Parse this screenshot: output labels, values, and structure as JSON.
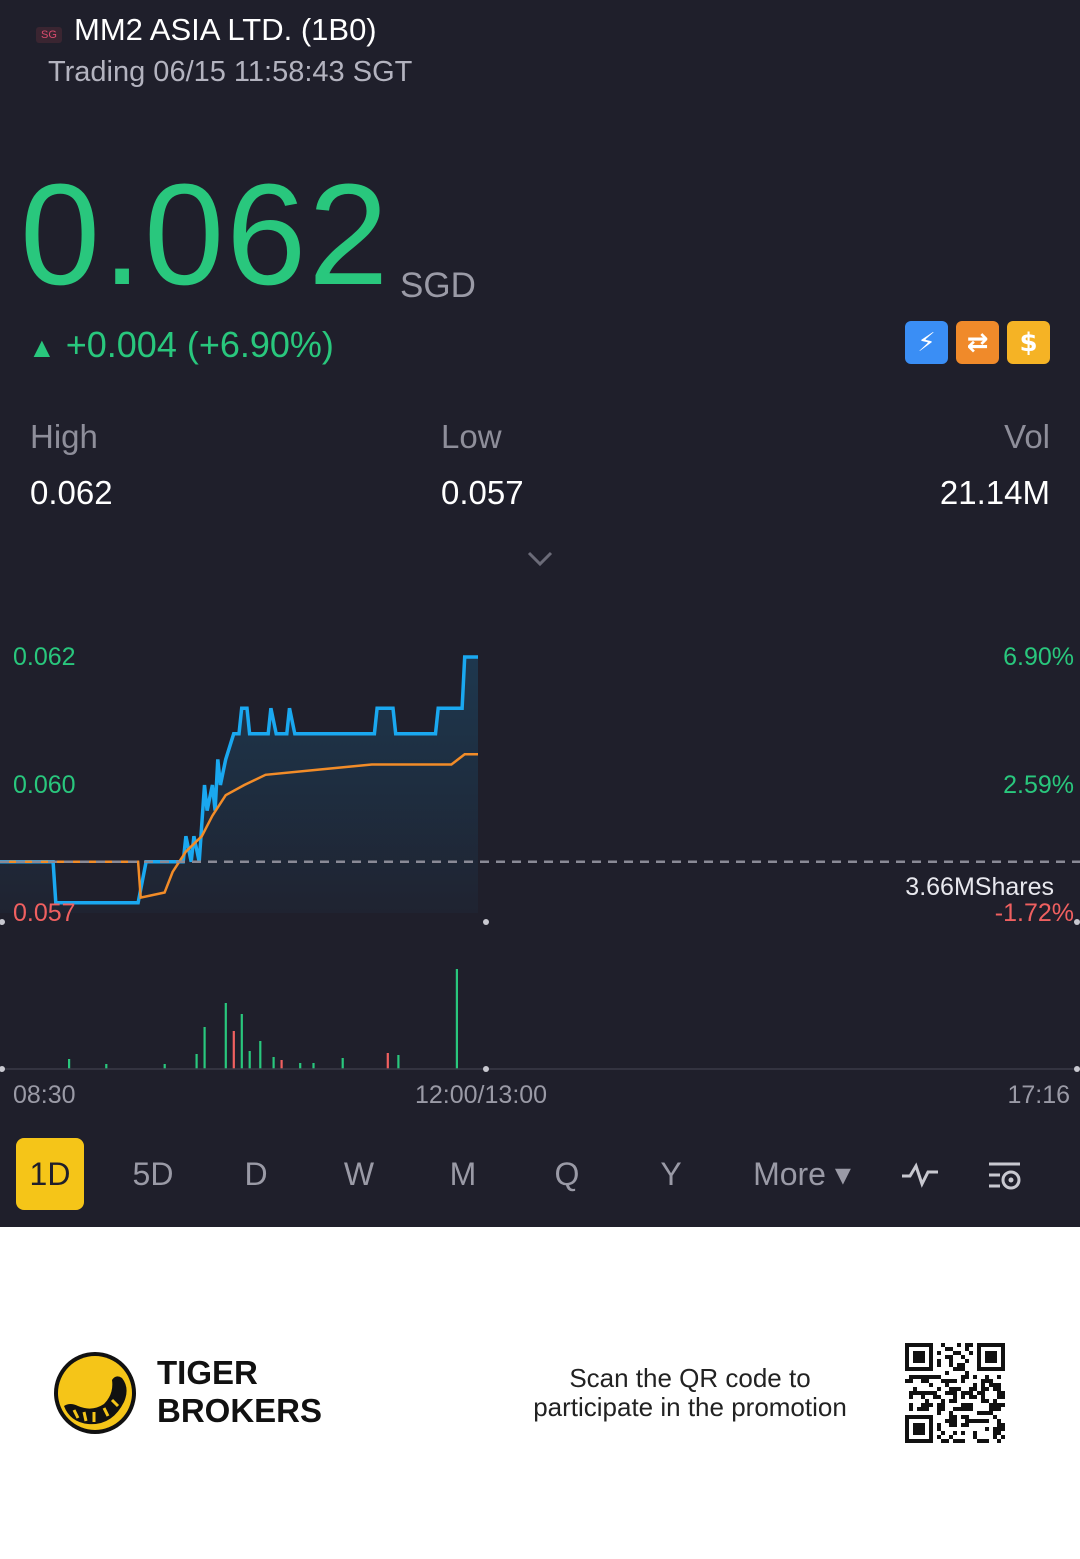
{
  "header": {
    "market": "SG",
    "title": "MM2 ASIA LTD. (1B0)",
    "status_time": "Trading 06/15 11:58:43 SGT"
  },
  "quote": {
    "price": "0.062",
    "currency": "SGD",
    "change_arrow": "▲",
    "change": "+0.004 (+6.90%)",
    "color_up": "#29c77d"
  },
  "feature_badges": [
    {
      "icon": "lightning-icon",
      "text": "⚡"
    },
    {
      "icon": "swap-icon",
      "text": "⇄"
    },
    {
      "icon": "dollar-icon",
      "text": "$"
    }
  ],
  "stats": {
    "high_label": "High",
    "high_value": "0.062",
    "low_label": "Low",
    "low_value": "0.057",
    "vol_label": "Vol",
    "vol_value": "21.14M"
  },
  "chart_data": {
    "type": "line",
    "x_labels": [
      "08:30",
      "12:00/13:00",
      "17:16"
    ],
    "y_labels_left": [
      "0.062",
      "0.060",
      "0.057"
    ],
    "y_labels_right": [
      "6.90%",
      "2.59%",
      "-1.72%"
    ],
    "ylim": [
      0.057,
      0.062
    ],
    "prev_close": 0.058,
    "volume_label": "3.66MShares",
    "series": [
      {
        "color": "#1aa8f0",
        "points": [
          [
            0,
            0.058
          ],
          [
            0.02,
            0.058
          ],
          [
            0.021,
            0.0572
          ],
          [
            0.052,
            0.0572
          ],
          [
            0.055,
            0.058
          ],
          [
            0.069,
            0.058
          ],
          [
            0.07,
            0.0585
          ],
          [
            0.072,
            0.058
          ],
          [
            0.073,
            0.0585
          ],
          [
            0.075,
            0.058
          ],
          [
            0.077,
            0.0595
          ],
          [
            0.078,
            0.059
          ],
          [
            0.08,
            0.0595
          ],
          [
            0.081,
            0.059
          ],
          [
            0.082,
            0.06
          ],
          [
            0.083,
            0.0595
          ],
          [
            0.085,
            0.06
          ],
          [
            0.088,
            0.0605
          ],
          [
            0.09,
            0.0605
          ],
          [
            0.091,
            0.061
          ],
          [
            0.093,
            0.061
          ],
          [
            0.094,
            0.0605
          ],
          [
            0.101,
            0.0605
          ],
          [
            0.102,
            0.061
          ],
          [
            0.104,
            0.0605
          ],
          [
            0.108,
            0.0605
          ],
          [
            0.109,
            0.061
          ],
          [
            0.111,
            0.0605
          ],
          [
            0.141,
            0.0605
          ],
          [
            0.142,
            0.061
          ],
          [
            0.148,
            0.061
          ],
          [
            0.149,
            0.0605
          ],
          [
            0.164,
            0.0605
          ],
          [
            0.165,
            0.061
          ],
          [
            0.174,
            0.061
          ],
          [
            0.175,
            0.062
          ],
          [
            0.18,
            0.062
          ]
        ]
      },
      {
        "color": "#f28c28",
        "points": [
          [
            0,
            0.058
          ],
          [
            0.052,
            0.058
          ],
          [
            0.053,
            0.0573
          ],
          [
            0.062,
            0.0574
          ],
          [
            0.065,
            0.0578
          ],
          [
            0.07,
            0.0582
          ],
          [
            0.076,
            0.0585
          ],
          [
            0.08,
            0.0589
          ],
          [
            0.085,
            0.0593
          ],
          [
            0.092,
            0.0595
          ],
          [
            0.1,
            0.0597
          ],
          [
            0.12,
            0.0598
          ],
          [
            0.14,
            0.0599
          ],
          [
            0.17,
            0.0599
          ],
          [
            0.175,
            0.0601
          ],
          [
            0.18,
            0.0601
          ]
        ]
      }
    ],
    "volume_bars": [
      {
        "x": 0.026,
        "h": 0.1,
        "color": "#29c77d"
      },
      {
        "x": 0.04,
        "h": 0.05,
        "color": "#29c77d"
      },
      {
        "x": 0.062,
        "h": 0.05,
        "color": "#29c77d"
      },
      {
        "x": 0.074,
        "h": 0.15,
        "color": "#29c77d"
      },
      {
        "x": 0.077,
        "h": 0.42,
        "color": "#29c77d"
      },
      {
        "x": 0.085,
        "h": 0.66,
        "color": "#29c77d"
      },
      {
        "x": 0.088,
        "h": 0.38,
        "color": "#f06060"
      },
      {
        "x": 0.091,
        "h": 0.55,
        "color": "#29c77d"
      },
      {
        "x": 0.094,
        "h": 0.18,
        "color": "#29c77d"
      },
      {
        "x": 0.098,
        "h": 0.28,
        "color": "#29c77d"
      },
      {
        "x": 0.103,
        "h": 0.12,
        "color": "#29c77d"
      },
      {
        "x": 0.106,
        "h": 0.09,
        "color": "#f06060"
      },
      {
        "x": 0.113,
        "h": 0.06,
        "color": "#29c77d"
      },
      {
        "x": 0.118,
        "h": 0.06,
        "color": "#29c77d"
      },
      {
        "x": 0.129,
        "h": 0.11,
        "color": "#29c77d"
      },
      {
        "x": 0.146,
        "h": 0.16,
        "color": "#f06060"
      },
      {
        "x": 0.15,
        "h": 0.14,
        "color": "#29c77d"
      },
      {
        "x": 0.172,
        "h": 1.0,
        "color": "#29c77d"
      }
    ]
  },
  "periods": {
    "p1d": "1D",
    "p5d": "5D",
    "pd": "D",
    "pw": "W",
    "pm": "M",
    "pq": "Q",
    "py": "Y",
    "more": "More ▾"
  },
  "footer": {
    "brand_line1": "TIGER",
    "brand_line2": "BROKERS",
    "promo_line1": "Scan the QR code to",
    "promo_line2": "participate in the promotion"
  }
}
